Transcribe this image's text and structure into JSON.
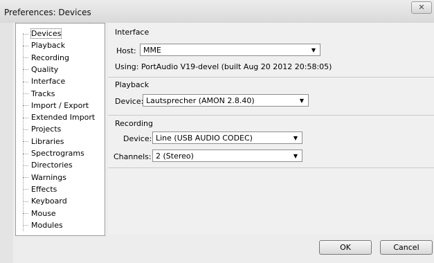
{
  "window": {
    "title": "Preferences: Devices",
    "close_glyph": "✕"
  },
  "sidebar": {
    "items": [
      {
        "label": "Devices",
        "selected": true
      },
      {
        "label": "Playback"
      },
      {
        "label": "Recording"
      },
      {
        "label": "Quality"
      },
      {
        "label": "Interface"
      },
      {
        "label": "Tracks"
      },
      {
        "label": "Import / Export"
      },
      {
        "label": "Extended Import"
      },
      {
        "label": "Projects"
      },
      {
        "label": "Libraries"
      },
      {
        "label": "Spectrograms"
      },
      {
        "label": "Directories"
      },
      {
        "label": "Warnings"
      },
      {
        "label": "Effects"
      },
      {
        "label": "Keyboard"
      },
      {
        "label": "Mouse"
      },
      {
        "label": "Modules"
      }
    ]
  },
  "interface": {
    "title": "Interface",
    "host_label": "Host:",
    "host_value": "MME",
    "using_text": "Using: PortAudio V19-devel (built Aug 20 2012 20:58:05)"
  },
  "playback": {
    "title": "Playback",
    "device_label": "Device:",
    "device_value": "Lautsprecher (AMON 2.8.40)"
  },
  "recording": {
    "title": "Recording",
    "device_label": "Device:",
    "device_value": "Line (USB AUDIO  CODEC)",
    "channels_label": "Channels:",
    "channels_value": "2 (Stereo)"
  },
  "buttons": {
    "ok": "OK",
    "cancel": "Cancel"
  },
  "icons": {
    "dropdown": "chevron-down-icon",
    "close": "close-icon"
  }
}
